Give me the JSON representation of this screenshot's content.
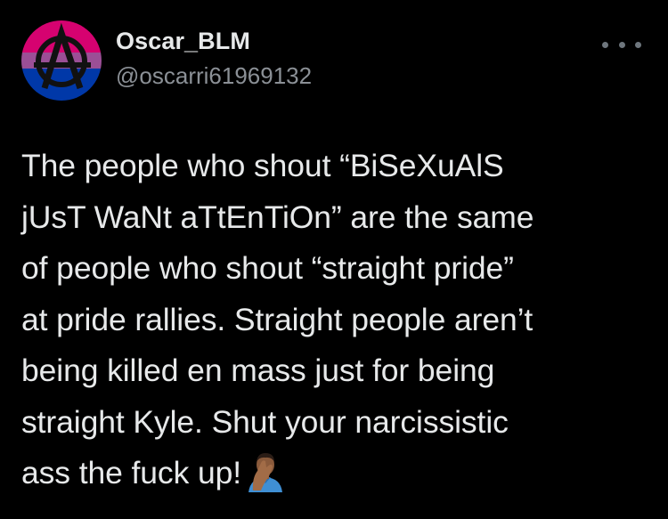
{
  "tweet": {
    "author": {
      "display_name": "Oscar_BLM",
      "handle": "@oscarri61969132",
      "avatar_icon": "anarchy-symbol-bisexual-flag-avatar",
      "avatar_colors": [
        "#d60270",
        "#9b4f96",
        "#0038a8"
      ]
    },
    "more_icon": "more-horizontal-icon",
    "text_lines": [
      "The people who shout “BiSeXuAlS",
      "jUsT WaNt aTtEnTiOn” are the same",
      "of people who shout “straight pride”",
      "at pride rallies. Straight people aren’t",
      "being killed en mass just for being",
      "straight Kyle. Shut your narcissistic",
      "ass the fuck up!"
    ],
    "trailing_emoji": "man-facepalming-emoji"
  },
  "colors": {
    "background": "#000000",
    "text_primary": "#e7e9ea",
    "text_secondary": "#8b9096"
  }
}
